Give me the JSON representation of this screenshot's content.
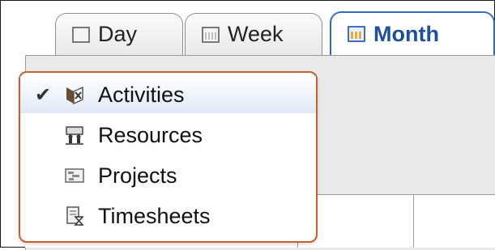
{
  "tabs": [
    {
      "label": "Day",
      "icon": "day-calendar-icon",
      "selected": false
    },
    {
      "label": "Week",
      "icon": "week-calendar-icon",
      "selected": false
    },
    {
      "label": "Month",
      "icon": "month-calendar-icon",
      "selected": true
    }
  ],
  "menu": {
    "items": [
      {
        "label": "Activities",
        "icon": "activities-icon",
        "checked": true
      },
      {
        "label": "Resources",
        "icon": "resources-icon",
        "checked": false
      },
      {
        "label": "Projects",
        "icon": "projects-icon",
        "checked": false
      },
      {
        "label": "Timesheets",
        "icon": "timesheets-icon",
        "checked": false
      }
    ],
    "check_mark": "✔"
  },
  "colors": {
    "selected_tab_border": "#2e6bc6",
    "selected_tab_text": "#1d4fa0",
    "menu_border": "#c7602a",
    "highlight_row": "#dfe9f7"
  }
}
